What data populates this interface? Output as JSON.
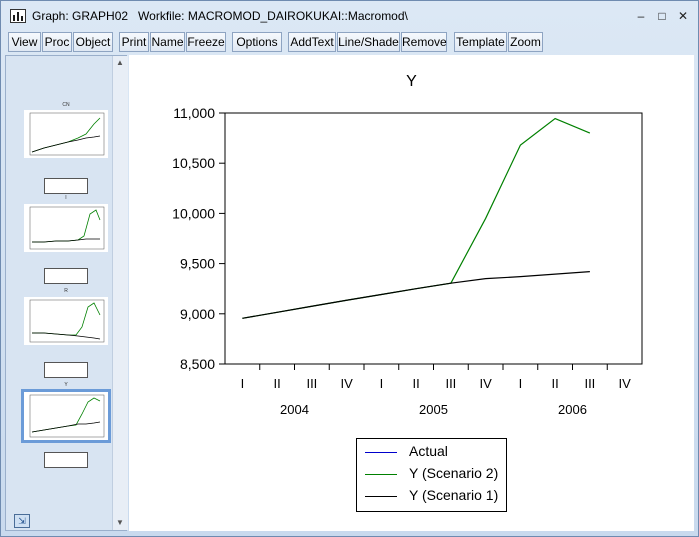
{
  "window": {
    "title": "Graph: GRAPH02   Workfile: MACROMOD_DAIROKUKAI::Macromod\\",
    "minimize": "–",
    "maximize": "□",
    "close": "✕"
  },
  "toolbar": {
    "buttons": [
      "View",
      "Proc",
      "Object",
      "Print",
      "Name",
      "Freeze",
      "Options",
      "AddText",
      "Line/Shade",
      "Remove",
      "Template",
      "Zoom"
    ]
  },
  "thumbnails": {
    "titles": [
      "CN",
      "I",
      "R",
      "Y"
    ],
    "selected_index": 3
  },
  "chart_data": {
    "type": "line",
    "title": "Y",
    "x": [
      "2004 I",
      "2004 II",
      "2004 III",
      "2004 IV",
      "2005 I",
      "2005 II",
      "2005 III",
      "2005 IV",
      "2006 I",
      "2006 II",
      "2006 III",
      "2006 IV"
    ],
    "quarter_labels": [
      "I",
      "II",
      "III",
      "IV",
      "I",
      "II",
      "III",
      "IV",
      "I",
      "II",
      "III",
      "IV"
    ],
    "year_labels": [
      "2004",
      "2005",
      "2006"
    ],
    "ylim": [
      8500,
      11000
    ],
    "yticks": [
      8500,
      9000,
      9500,
      10000,
      10500,
      11000
    ],
    "ytick_labels": [
      "8,500",
      "9,000",
      "9,500",
      "10,000",
      "10,500",
      "11,000"
    ],
    "series": [
      {
        "name": "Actual",
        "color": "#0000cc",
        "values": []
      },
      {
        "name": "Y (Scenario 2)",
        "color": "#008000",
        "values": [
          8955,
          9015,
          9075,
          9135,
          9192,
          9250,
          9305,
          9950,
          10680,
          10945,
          10800
        ],
        "start_index": 0,
        "note_offset": 0
      },
      {
        "name": "Y (Scenario 1)",
        "color": "#000000",
        "values": [
          8955,
          9015,
          9075,
          9135,
          9192,
          9250,
          9305,
          9350,
          9370,
          9395,
          9420
        ]
      }
    ]
  }
}
